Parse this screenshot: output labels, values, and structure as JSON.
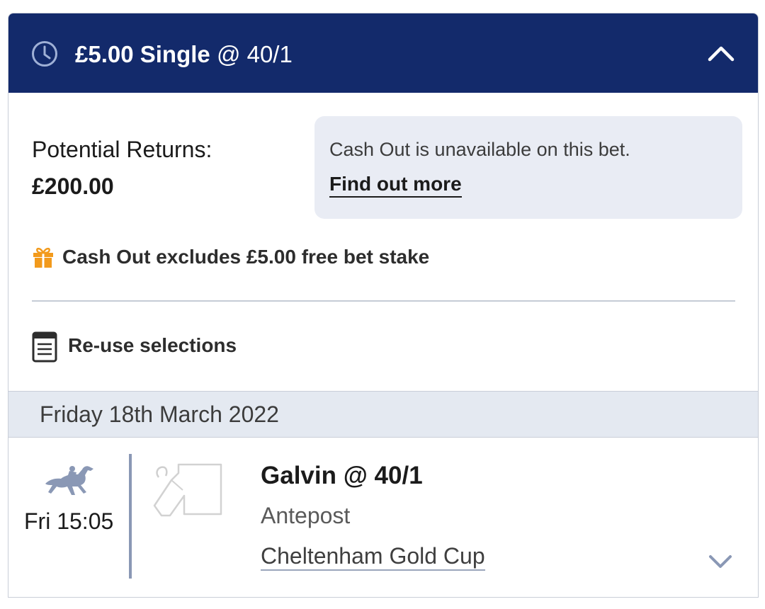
{
  "header": {
    "stake_type": "£5.00 Single",
    "odds": "@ 40/1"
  },
  "returns": {
    "label": "Potential Returns:",
    "value": "£200.00"
  },
  "cashout": {
    "message": "Cash Out is unavailable on this bet.",
    "link": "Find out more",
    "free_bet_note": "Cash Out excludes £5.00 free bet stake"
  },
  "reuse": {
    "label": "Re-use selections"
  },
  "date_header": "Friday 18th March 2022",
  "selection": {
    "time": "Fri 15:05",
    "name": "Galvin @ 40/1",
    "market": "Antepost",
    "event": "Cheltenham Gold Cup"
  },
  "colors": {
    "header_bg": "#132a6b",
    "cashout_box_bg": "#e9ecf4",
    "date_bar_bg": "#e4e9f1",
    "gift_orange": "#f29a1c",
    "icon_slate": "#8a98b5"
  },
  "icons": [
    "clock-icon",
    "chevron-up-icon",
    "gift-icon",
    "document-icon",
    "horse-racing-icon",
    "silks-icon",
    "chevron-down-icon"
  ]
}
